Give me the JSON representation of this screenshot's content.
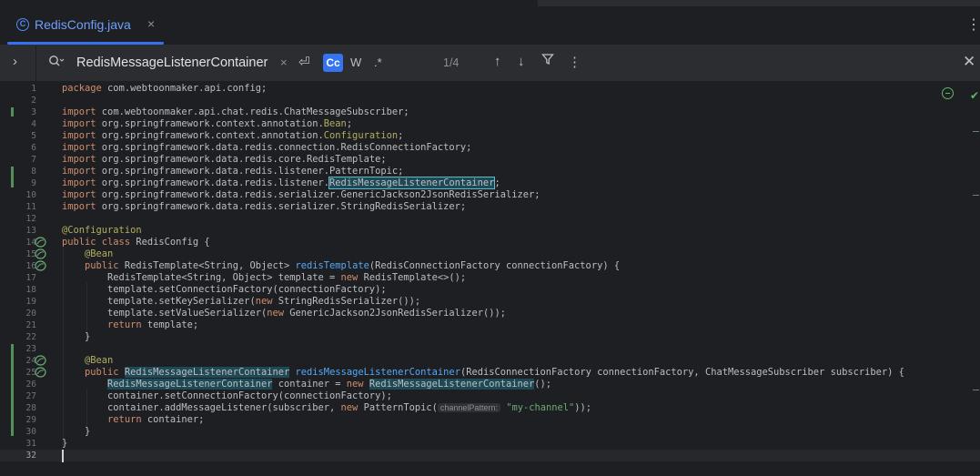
{
  "tab": {
    "title": "RedisConfig.java",
    "icon": "java-class-icon",
    "close": "×"
  },
  "toolbar": {
    "more": "⋮"
  },
  "find": {
    "expander": "›",
    "query": "RedisMessageListenerContainer",
    "clear": "×",
    "newline": "⏎",
    "match_case": "Cc",
    "words": "W",
    "regex": ".*",
    "count": "1/4",
    "up": "↑",
    "down": "↓",
    "filter": "⛉",
    "more": "⋮",
    "close": "✕"
  },
  "editor": {
    "line_numbers": [
      "1",
      "2",
      "3",
      "4",
      "5",
      "6",
      "7",
      "8",
      "9",
      "10",
      "11",
      "12",
      "13",
      "14",
      "15",
      "16",
      "17",
      "18",
      "19",
      "20",
      "21",
      "22",
      "23",
      "24",
      "25",
      "26",
      "27",
      "28",
      "29",
      "30",
      "31",
      "32"
    ],
    "l1": [
      "package",
      " com.webtoonmaker.api.config;"
    ],
    "l3": [
      "import",
      " com.webtoonmaker.api.chat.redis.ChatMessageSubscriber;"
    ],
    "l4": [
      "import",
      " org.springframework.context.annotation.",
      "Bean",
      ";"
    ],
    "l5": [
      "import",
      " org.springframework.context.annotation.",
      "Configuration",
      ";"
    ],
    "l6": [
      "import",
      " org.springframework.data.redis.connection.RedisConnectionFactory;"
    ],
    "l7": [
      "import",
      " org.springframework.data.redis.core.RedisTemplate;"
    ],
    "l8": [
      "import",
      " org.springframework.data.redis.listener.PatternTopic;"
    ],
    "l9": [
      "import",
      " org.springframework.data.redis.listener.",
      "RedisMessageListenerContainer",
      ";"
    ],
    "l10": [
      "import",
      " org.springframework.data.redis.serializer.GenericJackson2JsonRedisSerializer;"
    ],
    "l11": [
      "import",
      " org.springframework.data.redis.serializer.StringRedisSerializer;"
    ],
    "l13": [
      "@Configuration"
    ],
    "l14": [
      "public class",
      " RedisConfig {"
    ],
    "l15": [
      "    ",
      "@Bean"
    ],
    "l16": [
      "    ",
      "public",
      " RedisTemplate<String, Object> ",
      "redisTemplate",
      "(RedisConnectionFactory connectionFactory) {"
    ],
    "l17": [
      "        RedisTemplate<String, Object> template = ",
      "new",
      " RedisTemplate<>();"
    ],
    "l18": [
      "        template.setConnectionFactory(connectionFactory);"
    ],
    "l19": [
      "        template.setKeySerializer(",
      "new",
      " StringRedisSerializer());"
    ],
    "l20": [
      "        template.setValueSerializer(",
      "new",
      " GenericJackson2JsonRedisSerializer());"
    ],
    "l21": [
      "        ",
      "return",
      " template;"
    ],
    "l22": [
      "    }"
    ],
    "l24": [
      "    ",
      "@Bean"
    ],
    "l25": [
      "    ",
      "public",
      " ",
      "RedisMessageListenerContainer",
      " ",
      "redisMessageListenerContainer",
      "(RedisConnectionFactory connectionFactory, ChatMessageSubscriber subscriber) {"
    ],
    "l26": [
      "        ",
      "RedisMessageListenerContainer",
      " container = ",
      "new",
      " ",
      "RedisMessageListenerContainer",
      "();"
    ],
    "l27": [
      "        container.setConnectionFactory(connectionFactory);"
    ],
    "l28": [
      "        container.addMessageListener(subscriber, ",
      "new",
      " PatternTopic(",
      "channelPattern:",
      " ",
      "\"my-channel\"",
      "));"
    ],
    "l29": [
      "        ",
      "return",
      " container;"
    ],
    "l30": [
      "    }"
    ],
    "l31": [
      "}"
    ]
  }
}
